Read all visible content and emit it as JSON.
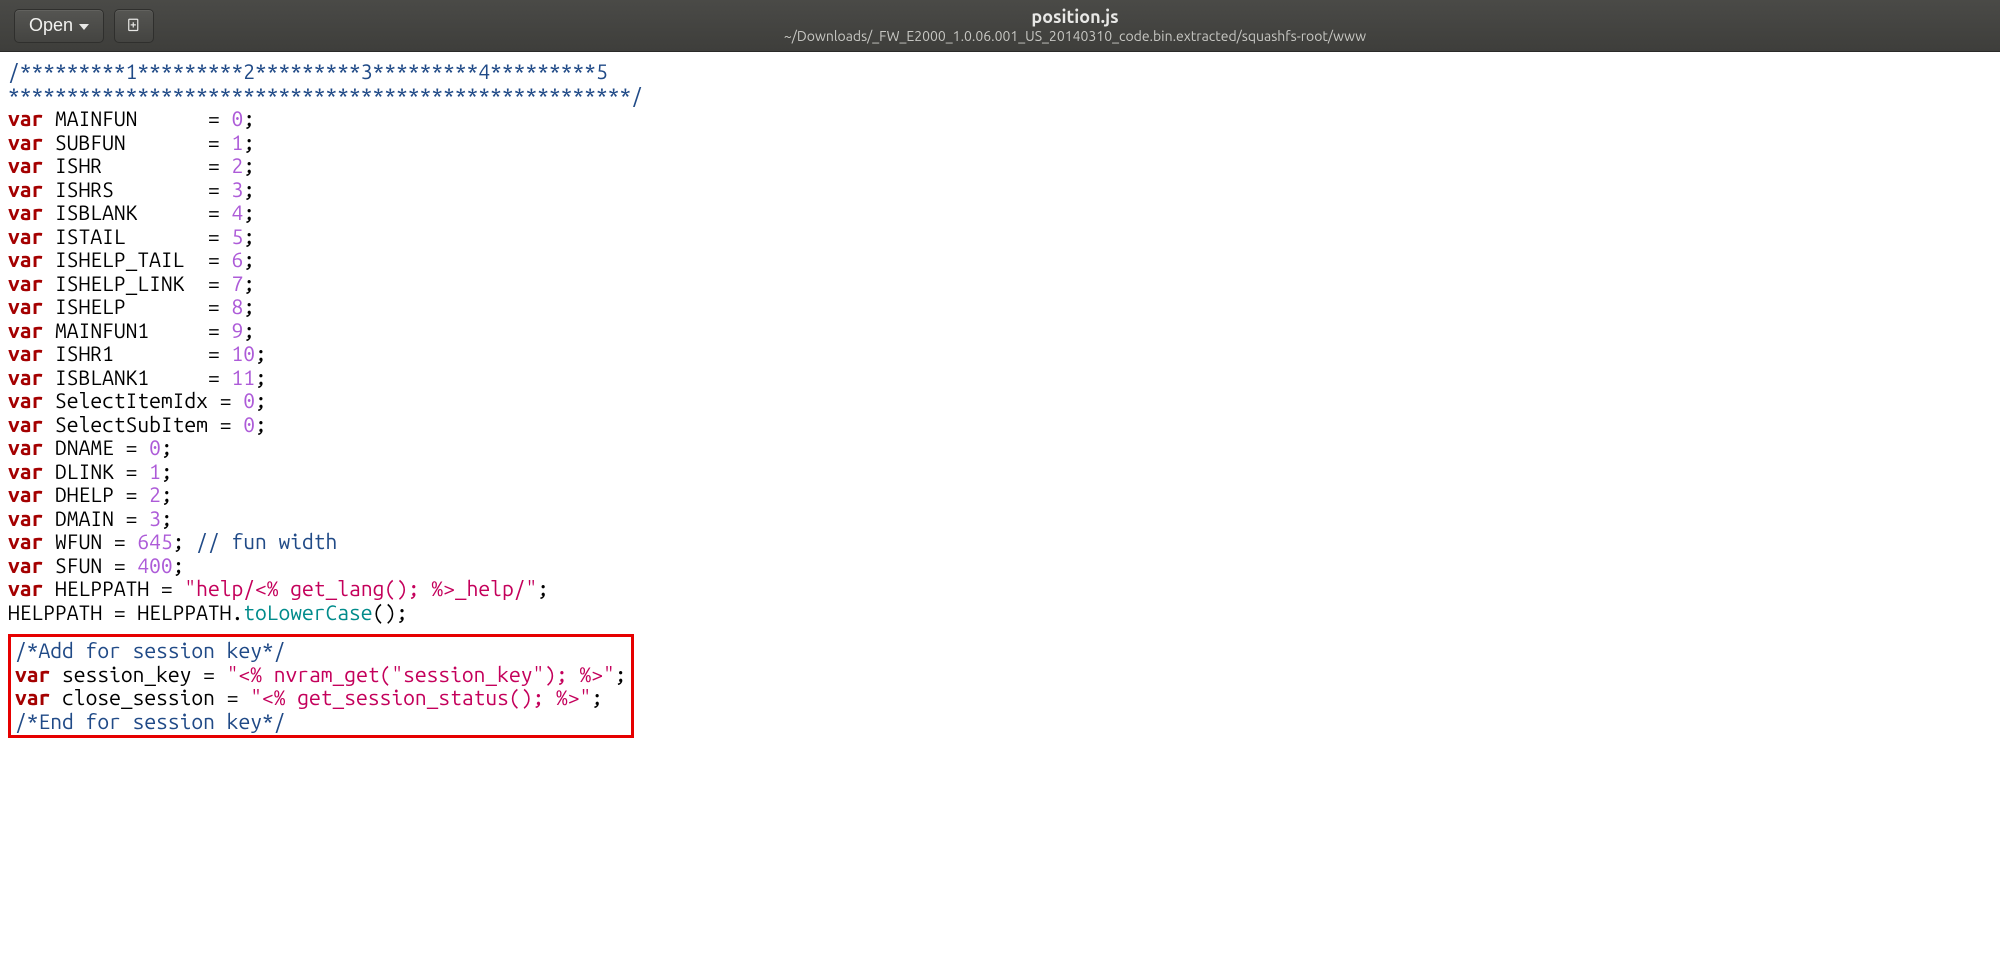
{
  "titlebar": {
    "open_label": "Open",
    "title": "position.js",
    "subtitle": "~/Downloads/_FW_E2000_1.0.06.001_US_20140310_code.bin.extracted/squashfs-root/www"
  },
  "code": {
    "header_comment_line1": "/*********1*********2*********3*********4*********5",
    "header_comment_line2": "*****************************************************/",
    "kw_var": "var",
    "vars": {
      "MAINFUN": {
        "pad": "     ",
        "val": "0"
      },
      "SUBFUN": {
        "pad": "      ",
        "val": "1"
      },
      "ISHR": {
        "pad": "        ",
        "val": "2"
      },
      "ISHRS": {
        "pad": "       ",
        "val": "3"
      },
      "ISBLANK": {
        "pad": "     ",
        "val": "4"
      },
      "ISTAIL": {
        "pad": "      ",
        "val": "5"
      },
      "ISHELP_TAIL": {
        "pad": " ",
        "val": "6"
      },
      "ISHELP_LINK": {
        "pad": " ",
        "val": "7"
      },
      "ISHELP": {
        "pad": "      ",
        "val": "8"
      },
      "MAINFUN1": {
        "pad": "    ",
        "val": "9"
      },
      "ISHR1": {
        "pad": "       ",
        "val": "10"
      },
      "ISBLANK1": {
        "pad": "    ",
        "val": "11"
      }
    },
    "select_item_idx": {
      "name": "SelectItemIdx",
      "val": "0"
    },
    "select_sub_item": {
      "name": "SelectSubItem",
      "val": "0"
    },
    "d": {
      "DNAME": "0",
      "DLINK": "1",
      "DHELP": "2",
      "DMAIN": "3"
    },
    "wfun": {
      "name": "WFUN",
      "val": "645",
      "comment": " // fun width"
    },
    "sfun": {
      "name": "SFUN",
      "val": "400"
    },
    "helppath_decl": {
      "name": "HELPPATH",
      "val": "\"help/<% get_lang(); %>_help/\""
    },
    "helppath_assign_left": "HELPPATH = HELPPATH.",
    "helppath_fn": "toLowerCase",
    "helppath_assign_right": "();",
    "session": {
      "cmt_start": "/*Add for session key*/",
      "line1_name": "session_key",
      "line1_val": "\"<% nvram_get(\"session_key\"); %>\"",
      "line2_name": "close_session",
      "line2_val": "\"<% get_session_status(); %>\"",
      "cmt_end": "/*End for session key*/"
    }
  }
}
